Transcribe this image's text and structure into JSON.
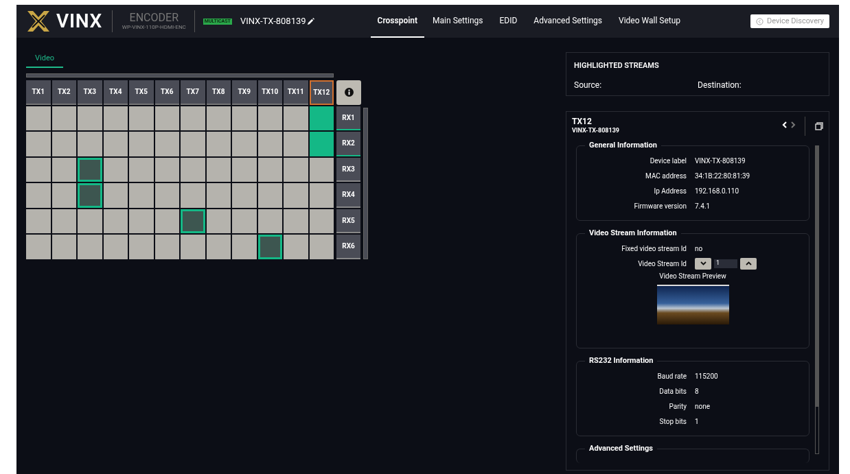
{
  "header": {
    "brand": "VINX",
    "device_type": "ENCODER",
    "model": "WP-VINX-110P-HDMI-ENC",
    "mode_badge": "MULTICAST",
    "device_name": "VINX-TX-808139",
    "nav": [
      {
        "label": "Crosspoint",
        "selected": true
      },
      {
        "label": "Main Settings",
        "selected": false
      },
      {
        "label": "EDID",
        "selected": false
      },
      {
        "label": "Advanced Settings",
        "selected": false
      },
      {
        "label": "Video Wall Setup",
        "selected": false
      }
    ],
    "discovery_button": "Device Discovery"
  },
  "crosspoint": {
    "tabs": [
      {
        "label": "Video",
        "selected": true
      }
    ],
    "columns": [
      {
        "label": "TX1",
        "selected": false
      },
      {
        "label": "TX2",
        "selected": false
      },
      {
        "label": "TX3",
        "selected": false
      },
      {
        "label": "TX4",
        "selected": false
      },
      {
        "label": "TX5",
        "selected": false
      },
      {
        "label": "TX6",
        "selected": false
      },
      {
        "label": "TX7",
        "selected": false
      },
      {
        "label": "TX8",
        "selected": false
      },
      {
        "label": "TX9",
        "selected": false
      },
      {
        "label": "TX10",
        "selected": false
      },
      {
        "label": "TX11",
        "selected": false
      },
      {
        "label": "TX12",
        "selected": true
      }
    ],
    "rows": [
      {
        "label": "RX1",
        "selected": true,
        "cells": [
          {
            "kind": "off"
          },
          {
            "kind": "off"
          },
          {
            "kind": "off"
          },
          {
            "kind": "off"
          },
          {
            "kind": "off"
          },
          {
            "kind": "off"
          },
          {
            "kind": "off"
          },
          {
            "kind": "off"
          },
          {
            "kind": "off"
          },
          {
            "kind": "off"
          },
          {
            "kind": "off"
          },
          {
            "kind": "connected"
          }
        ]
      },
      {
        "label": "RX2",
        "selected": true,
        "cells": [
          {
            "kind": "off"
          },
          {
            "kind": "off"
          },
          {
            "kind": "off"
          },
          {
            "kind": "off"
          },
          {
            "kind": "off"
          },
          {
            "kind": "off"
          },
          {
            "kind": "off"
          },
          {
            "kind": "off"
          },
          {
            "kind": "off"
          },
          {
            "kind": "off"
          },
          {
            "kind": "off"
          },
          {
            "kind": "connected"
          }
        ]
      },
      {
        "label": "RX3",
        "selected": false,
        "cells": [
          {
            "kind": "off"
          },
          {
            "kind": "off"
          },
          {
            "kind": "routed"
          },
          {
            "kind": "off"
          },
          {
            "kind": "off"
          },
          {
            "kind": "off"
          },
          {
            "kind": "off"
          },
          {
            "kind": "off"
          },
          {
            "kind": "off"
          },
          {
            "kind": "off"
          },
          {
            "kind": "off"
          },
          {
            "kind": "off"
          }
        ]
      },
      {
        "label": "RX4",
        "selected": false,
        "cells": [
          {
            "kind": "off"
          },
          {
            "kind": "off"
          },
          {
            "kind": "routed"
          },
          {
            "kind": "off"
          },
          {
            "kind": "off"
          },
          {
            "kind": "off"
          },
          {
            "kind": "off"
          },
          {
            "kind": "off"
          },
          {
            "kind": "off"
          },
          {
            "kind": "off"
          },
          {
            "kind": "off"
          },
          {
            "kind": "off"
          }
        ]
      },
      {
        "label": "RX5",
        "selected": false,
        "cells": [
          {
            "kind": "off"
          },
          {
            "kind": "off"
          },
          {
            "kind": "off"
          },
          {
            "kind": "off"
          },
          {
            "kind": "off"
          },
          {
            "kind": "off"
          },
          {
            "kind": "routed"
          },
          {
            "kind": "off"
          },
          {
            "kind": "off"
          },
          {
            "kind": "off"
          },
          {
            "kind": "off"
          },
          {
            "kind": "off"
          }
        ]
      },
      {
        "label": "RX6",
        "selected": false,
        "cells": [
          {
            "kind": "off"
          },
          {
            "kind": "off"
          },
          {
            "kind": "off"
          },
          {
            "kind": "off"
          },
          {
            "kind": "off"
          },
          {
            "kind": "off"
          },
          {
            "kind": "off"
          },
          {
            "kind": "off"
          },
          {
            "kind": "off"
          },
          {
            "kind": "routed"
          },
          {
            "kind": "off"
          },
          {
            "kind": "off"
          }
        ]
      }
    ]
  },
  "highlighted_streams": {
    "title": "HIGHLIGHTED STREAMS",
    "source_label": "Source:",
    "destination_label": "Destination:"
  },
  "details": {
    "title": "TX12",
    "subtitle": "VINX-TX-808139",
    "sections": [
      {
        "title": "General Information",
        "rows": [
          {
            "label": "Device label",
            "value": "VINX-TX-808139"
          },
          {
            "label": "MAC address",
            "value": "34:1B:22:80:81:39"
          },
          {
            "label": "Ip Address",
            "value": "192.168.0.110"
          },
          {
            "label": "Firmware version",
            "value": "7.4.1"
          }
        ]
      },
      {
        "title": "Video Stream Information",
        "rows": [
          {
            "label": "Fixed video stream Id",
            "value": "no"
          }
        ],
        "stream_id": {
          "label": "Video Stream Id",
          "value": "1"
        },
        "preview_label": "Video Stream Preview"
      },
      {
        "title": "RS232 Information",
        "rows": [
          {
            "label": "Baud rate",
            "value": "115200"
          },
          {
            "label": "Data bits",
            "value": "8"
          },
          {
            "label": "Parity",
            "value": "none"
          },
          {
            "label": "Stop bits",
            "value": "1"
          }
        ]
      },
      {
        "title": "Advanced Settings"
      }
    ]
  }
}
